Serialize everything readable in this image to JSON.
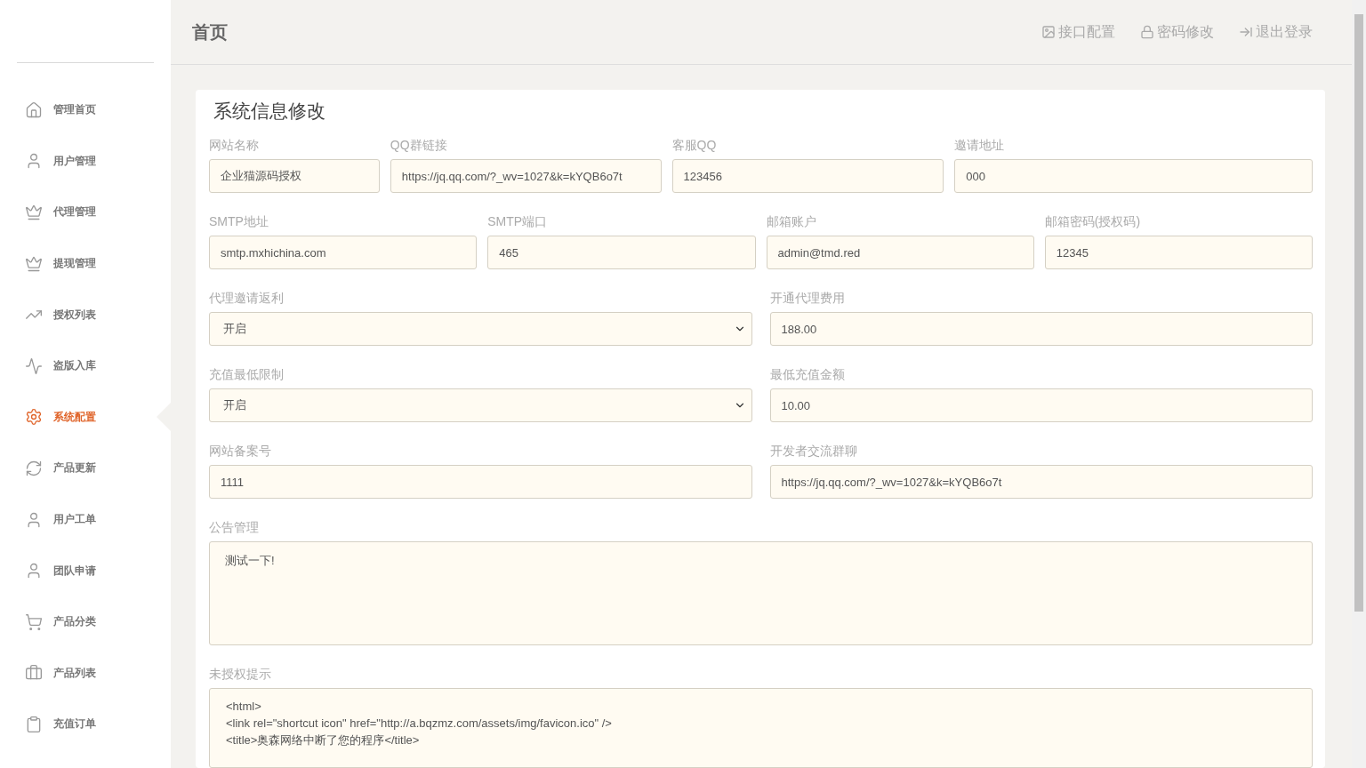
{
  "sidebar": {
    "items": [
      {
        "label": "管理首页",
        "selected": false
      },
      {
        "label": "用户管理",
        "selected": false
      },
      {
        "label": "代理管理",
        "selected": false
      },
      {
        "label": "提现管理",
        "selected": false
      },
      {
        "label": "授权列表",
        "selected": false
      },
      {
        "label": "盗版入库",
        "selected": false
      },
      {
        "label": "系统配置",
        "selected": true
      },
      {
        "label": "产品更新",
        "selected": false
      },
      {
        "label": "用户工单",
        "selected": false
      },
      {
        "label": "团队申请",
        "selected": false
      },
      {
        "label": "产品分类",
        "selected": false
      },
      {
        "label": "产品列表",
        "selected": false
      },
      {
        "label": "充值订单",
        "selected": false
      }
    ]
  },
  "header": {
    "title": "首页",
    "links": [
      "接口配置",
      "密码修改",
      "退出登录"
    ]
  },
  "form": {
    "title": "系统信息修改",
    "rows": [
      {
        "fields": [
          {
            "kind": "input",
            "label": "网站名称",
            "value": "企业猫源码授权"
          },
          {
            "kind": "input",
            "label": "QQ群链接",
            "value": "https://jq.qq.com/?_wv=1027&k=kYQB6o7t"
          },
          {
            "kind": "input",
            "label": "客服QQ",
            "value": "123456"
          },
          {
            "kind": "input",
            "label": "邀请地址",
            "value": "000"
          }
        ]
      },
      {
        "fields": [
          {
            "kind": "input",
            "label": "SMTP地址",
            "value": "smtp.mxhichina.com"
          },
          {
            "kind": "input",
            "label": "SMTP端口",
            "value": "465"
          },
          {
            "kind": "input",
            "label": "邮箱账户",
            "value": "admin@tmd.red"
          },
          {
            "kind": "input",
            "label": "邮箱密码(授权码)",
            "value": "12345"
          }
        ]
      },
      {
        "fields": [
          {
            "kind": "select",
            "label": "代理邀请返利",
            "value": "开启"
          },
          {
            "kind": "input",
            "label": "开通代理费用",
            "value": "188.00"
          }
        ]
      },
      {
        "fields": [
          {
            "kind": "select",
            "label": "充值最低限制",
            "value": "开启"
          },
          {
            "kind": "input",
            "label": "最低充值金额",
            "value": "10.00"
          }
        ]
      },
      {
        "fields": [
          {
            "kind": "input",
            "label": "网站备案号",
            "value": "1111"
          },
          {
            "kind": "input",
            "label": "开发者交流群聊",
            "value": "https://jq.qq.com/?_wv=1027&k=kYQB6o7t"
          }
        ]
      },
      {
        "fields": [
          {
            "kind": "textarea",
            "label": "公告管理",
            "value": "测试一下!"
          }
        ]
      },
      {
        "fields": [
          {
            "kind": "code",
            "label": "未授权提示",
            "value": "<html>\n<link rel=\"shortcut icon\" href=\"http://a.bqzmz.com/assets/img/favicon.ico\" />\n<title>奥森网络中断了您的程序</title>"
          }
        ]
      }
    ]
  }
}
